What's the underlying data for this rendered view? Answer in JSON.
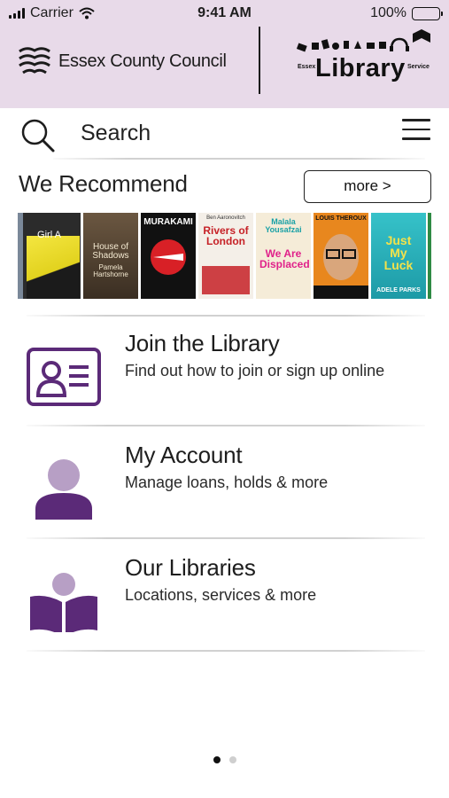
{
  "status": {
    "carrier": "Carrier",
    "time": "9:41 AM",
    "battery": "100%",
    "icons": [
      "signal-icon",
      "wifi-icon",
      "battery-icon"
    ]
  },
  "header": {
    "council_name": "Essex County Council",
    "library_word": "Library",
    "library_prefix": "Essex",
    "library_suffix": "Service"
  },
  "search": {
    "label": "Search"
  },
  "recommend": {
    "title": "We Recommend",
    "more_label": "more >",
    "books": [
      {
        "title": "Girl A",
        "author": ""
      },
      {
        "title": "House of Shadows",
        "author": "Pamela Hartshorne"
      },
      {
        "title": "",
        "author": "MURAKAMI"
      },
      {
        "title": "Rivers of London",
        "author": "Ben Aaronovitch"
      },
      {
        "title": "We Are Displaced",
        "author": "Malala Yousafzai"
      },
      {
        "title": "",
        "author": "LOUIS THEROUX"
      },
      {
        "title": "Just My Luck",
        "author": "ADELE PARKS"
      }
    ]
  },
  "menu": [
    {
      "title": "Join the Library",
      "subtitle": "Find out how to join or sign up online",
      "icon": "id-card-icon"
    },
    {
      "title": "My Account",
      "subtitle": "Manage loans, holds & more",
      "icon": "user-icon"
    },
    {
      "title": "Our Libraries",
      "subtitle": "Locations, services & more",
      "icon": "reader-book-icon"
    }
  ],
  "pager": {
    "pages": 2,
    "current": 1
  },
  "colors": {
    "header_bg": "#e8dae9",
    "accent_purple": "#5b2a78",
    "light_purple": "#b79fc5"
  }
}
